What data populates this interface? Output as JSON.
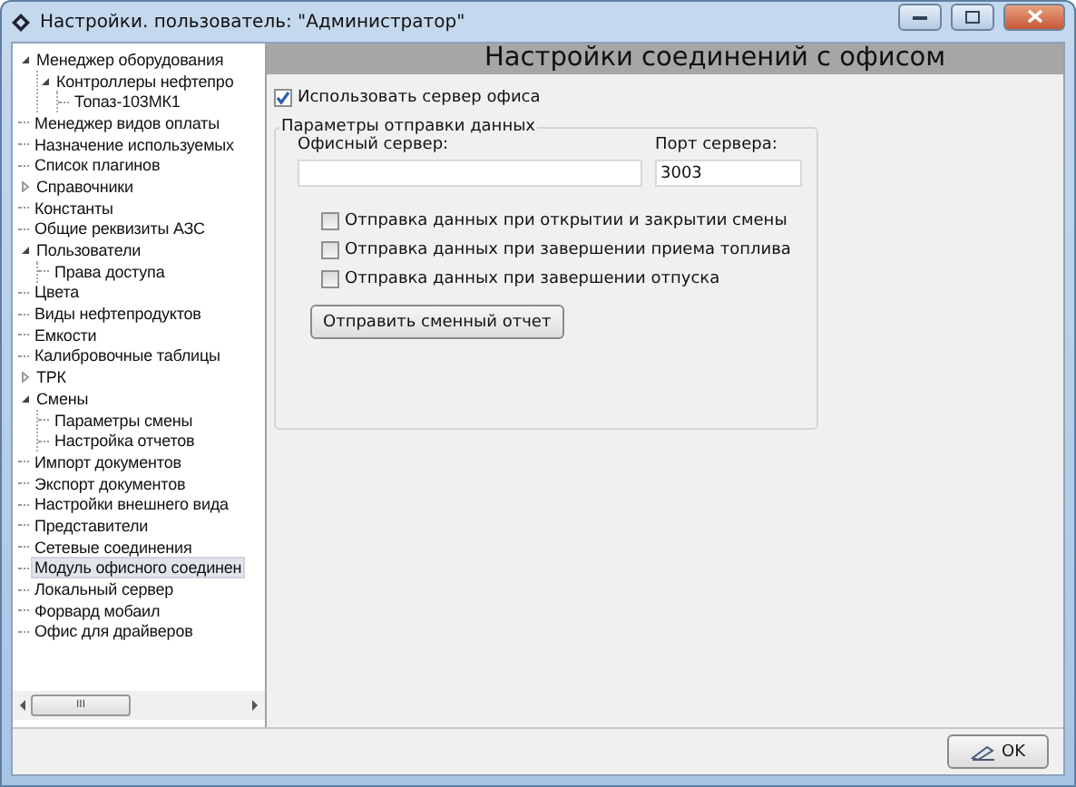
{
  "window": {
    "title": "Настройки. пользователь: \"Администратор\""
  },
  "tree": [
    {
      "label": "Менеджер оборудования",
      "expanded": true,
      "selected": false,
      "children": [
        {
          "label": "Контроллеры нефтепро",
          "expanded": true,
          "selected": false,
          "children": [
            {
              "label": "Топаз-103МК1",
              "selected": false
            }
          ]
        }
      ]
    },
    {
      "label": "Менеджер видов оплаты",
      "selected": false
    },
    {
      "label": "Назначение используемых",
      "selected": false
    },
    {
      "label": "Список плагинов",
      "selected": false
    },
    {
      "label": "Справочники",
      "expanded": false,
      "selected": false
    },
    {
      "label": "Константы",
      "selected": false
    },
    {
      "label": "Общие реквизиты АЗС",
      "selected": false
    },
    {
      "label": "Пользователи",
      "expanded": true,
      "selected": false,
      "children": [
        {
          "label": "Права доступа",
          "selected": false
        }
      ]
    },
    {
      "label": "Цвета",
      "selected": false
    },
    {
      "label": "Виды нефтепродуктов",
      "selected": false
    },
    {
      "label": "Емкости",
      "selected": false
    },
    {
      "label": "Калибровочные таблицы",
      "selected": false
    },
    {
      "label": "ТРК",
      "expanded": false,
      "selected": false
    },
    {
      "label": "Смены",
      "expanded": true,
      "selected": false,
      "children": [
        {
          "label": "Параметры смены",
          "selected": false
        },
        {
          "label": "Настройка отчетов",
          "selected": false
        }
      ]
    },
    {
      "label": "Импорт документов",
      "selected": false
    },
    {
      "label": "Экспорт документов",
      "selected": false
    },
    {
      "label": "Настройки внешнего вида",
      "selected": false
    },
    {
      "label": "Представители",
      "selected": false
    },
    {
      "label": "Сетевые соединения",
      "selected": false
    },
    {
      "label": "Модуль офисного соединен",
      "selected": true
    },
    {
      "label": "Локальный сервер",
      "selected": false
    },
    {
      "label": "Форвард мобаил",
      "selected": false
    },
    {
      "label": "Офис для драйверов",
      "selected": false
    }
  ],
  "tree_scrollbar": {
    "thumb": "III"
  },
  "panel": {
    "heading": "Настройки соединений с офисом",
    "use_server": {
      "label": "Использовать сервер офиса",
      "checked": true
    },
    "group": {
      "legend": "Параметры отправки данных",
      "server": {
        "label": "Офисный сервер:"
      },
      "port": {
        "label": "Порт сервера:",
        "value": "3003"
      },
      "options": [
        {
          "label": "Отправка данных при открытии и закрытии смены",
          "checked": false
        },
        {
          "label": "Отправка данных при завершении приема топлива",
          "checked": false
        },
        {
          "label": "Отправка данных при завершении отпуска",
          "checked": false
        }
      ],
      "send_button": "Отправить сменный отчет"
    }
  },
  "ok_button": "OK"
}
